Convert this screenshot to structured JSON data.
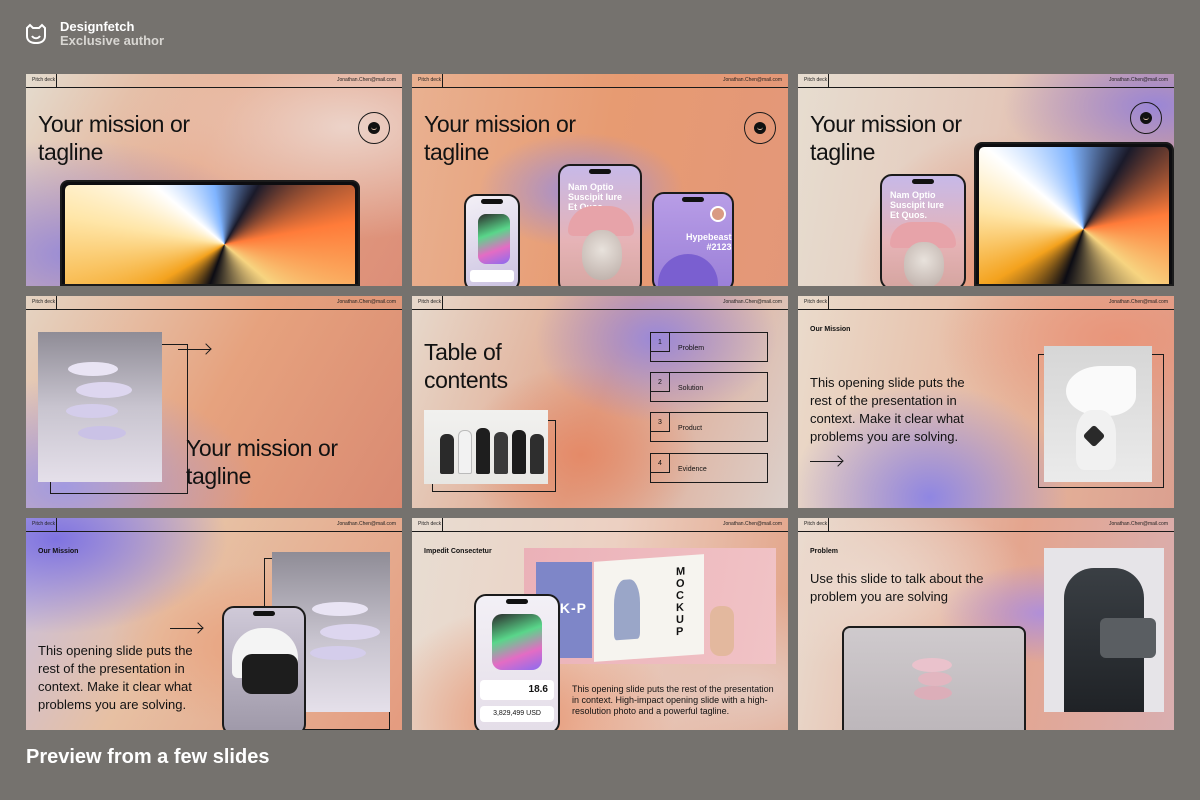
{
  "brand": {
    "name": "Designfetch",
    "subtitle": "Exclusive author"
  },
  "slide_header": {
    "left": "Pitch deck",
    "right": "Jonathan.Chen@mail.com"
  },
  "slides": {
    "s1": {
      "title_line1": "Your mission or",
      "title_line2": "tagline"
    },
    "s2": {
      "title_line1": "Your mission or",
      "title_line2": "tagline",
      "phone_center_text": [
        "Nam Optio",
        "Suscipit Iure",
        "Et Quos."
      ],
      "phone_right_text": [
        "Hypebeast",
        "#2123"
      ]
    },
    "s3": {
      "title_line1": "Your mission or",
      "title_line2": "tagline",
      "phone_text": [
        "Nam Optio",
        "Suscipit Iure",
        "Et Quos."
      ]
    },
    "s4": {
      "title_line1": "Your mission or",
      "title_line2": "tagline"
    },
    "s5": {
      "title_line1": "Table of",
      "title_line2": "contents",
      "toc": [
        {
          "num": "1",
          "label": "Problem"
        },
        {
          "num": "2",
          "label": "Solution"
        },
        {
          "num": "3",
          "label": "Product"
        },
        {
          "num": "4",
          "label": "Evidence"
        }
      ]
    },
    "s6": {
      "label": "Our Mission",
      "body": [
        "This opening slide puts the",
        "rest of the presentation in",
        "context. Make it clear what",
        "problems you are solving."
      ]
    },
    "s7": {
      "label": "Our Mission",
      "body": [
        "This opening slide puts the",
        "rest of the presentation in",
        "context. Make it clear what",
        "problems you are solving."
      ]
    },
    "s8": {
      "label": "Impedit Consectetur",
      "mockup_text": "MOCKUP",
      "mockup_cover": "OK-P",
      "price": "3,829,499 USD",
      "stat": "18.6",
      "body": [
        "This opening slide puts the rest of the presentation",
        "in context. High-impact opening slide with a high-",
        "resolution photo and a powerful tagline."
      ]
    },
    "s9": {
      "label": "Problem",
      "body": [
        "Use this slide to talk about the",
        "problem you are solving"
      ]
    }
  },
  "footer": {
    "caption": "Preview from a few slides"
  }
}
